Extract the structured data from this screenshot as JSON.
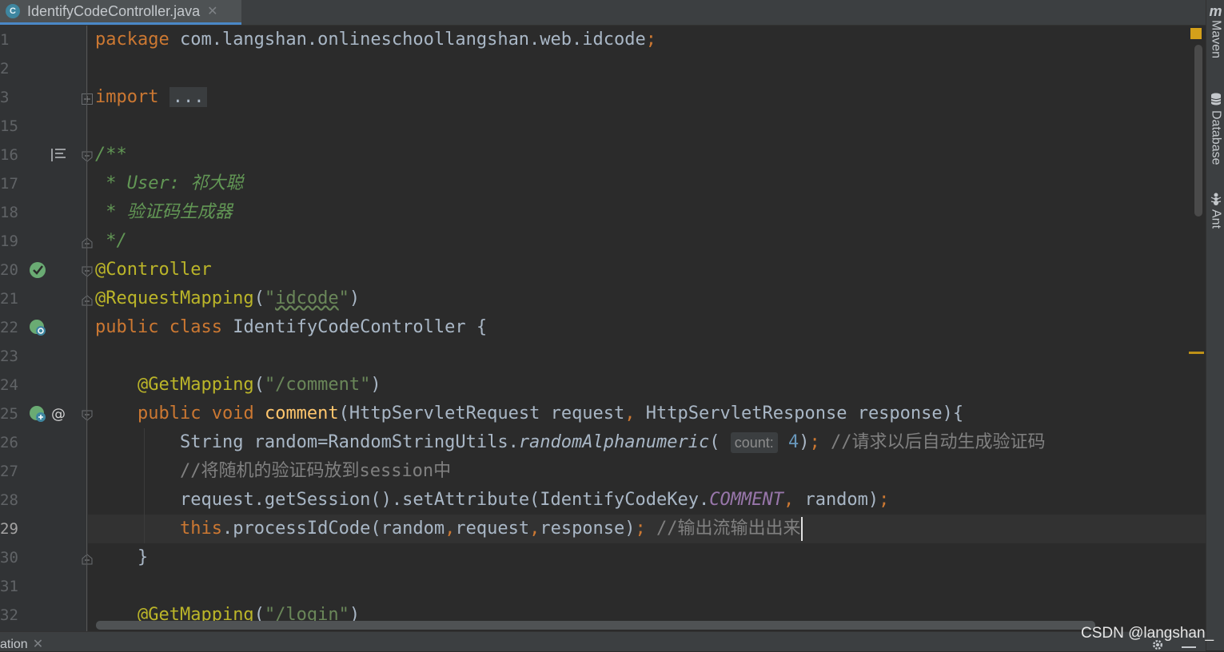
{
  "tab": {
    "icon_letter": "C",
    "filename": "IdentifyCodeController.java",
    "close": "✕"
  },
  "line_numbers": [
    "1",
    "2",
    "3",
    "15",
    "16",
    "17",
    "18",
    "19",
    "20",
    "21",
    "22",
    "23",
    "24",
    "25",
    "26",
    "27",
    "28",
    "29",
    "30",
    "31",
    "32"
  ],
  "current_line": "29",
  "code": {
    "l1": {
      "kw": "package",
      "pkg": " com.langshan.onlineschoollangshan.web.idcode",
      "semi": ";"
    },
    "l3": {
      "kw": "import",
      "placeholder": "..."
    },
    "l16": {
      "text": "/**"
    },
    "l17": {
      "text": " * User: 祁大聪"
    },
    "l18": {
      "text": " * 验证码生成器"
    },
    "l19": {
      "text": " */"
    },
    "l20": {
      "ann": "@Controller"
    },
    "l21": {
      "ann": "@RequestMapping",
      "open": "(",
      "q1": "\"",
      "str": "idcode",
      "q2": "\"",
      "close": ")"
    },
    "l22": {
      "kw": "public class",
      "name": " IdentifyCodeController {"
    },
    "l24": {
      "ann": "@GetMapping",
      "open": "(",
      "str": "\"/comment\"",
      "close": ")"
    },
    "l25": {
      "kw1": "public",
      "kw2": " void",
      "fn": " comment",
      "params1": "(HttpServletRequest request",
      "comma": ",",
      "params2": " HttpServletResponse response){"
    },
    "l26": {
      "a": "String random=RandomStringUtils.",
      "method": "randomAlphanumeric",
      "open": "(",
      "hint": "count:",
      "num": "4",
      "close": ")",
      "semi": ";",
      "cmt": " //请求以后自动生成验证码"
    },
    "l27": {
      "cmt": "//将随机的验证码放到session中"
    },
    "l28": {
      "a": "request.getSession().setAttribute(IdentifyCodeKey.",
      "const": "COMMENT",
      "comma": ",",
      "b": " random)",
      "semi": ";"
    },
    "l29": {
      "kw": "this",
      "a": ".processIdCode(random",
      "c1": ",",
      "b": "request",
      "c2": ",",
      "c": "response)",
      "semi": ";",
      "cmt": " //输出流输出出来"
    },
    "l30": {
      "text": "}"
    },
    "l32": {
      "ann": "@GetMapping",
      "open": "(",
      "str": "\"/login\"",
      "close": ")"
    }
  },
  "tool_windows": {
    "maven": "Maven",
    "maven_icon": "m",
    "database": "Database",
    "ant": "Ant"
  },
  "bottom": {
    "tab_label": "ation",
    "close": "✕"
  },
  "watermark": "CSDN @langshan_"
}
